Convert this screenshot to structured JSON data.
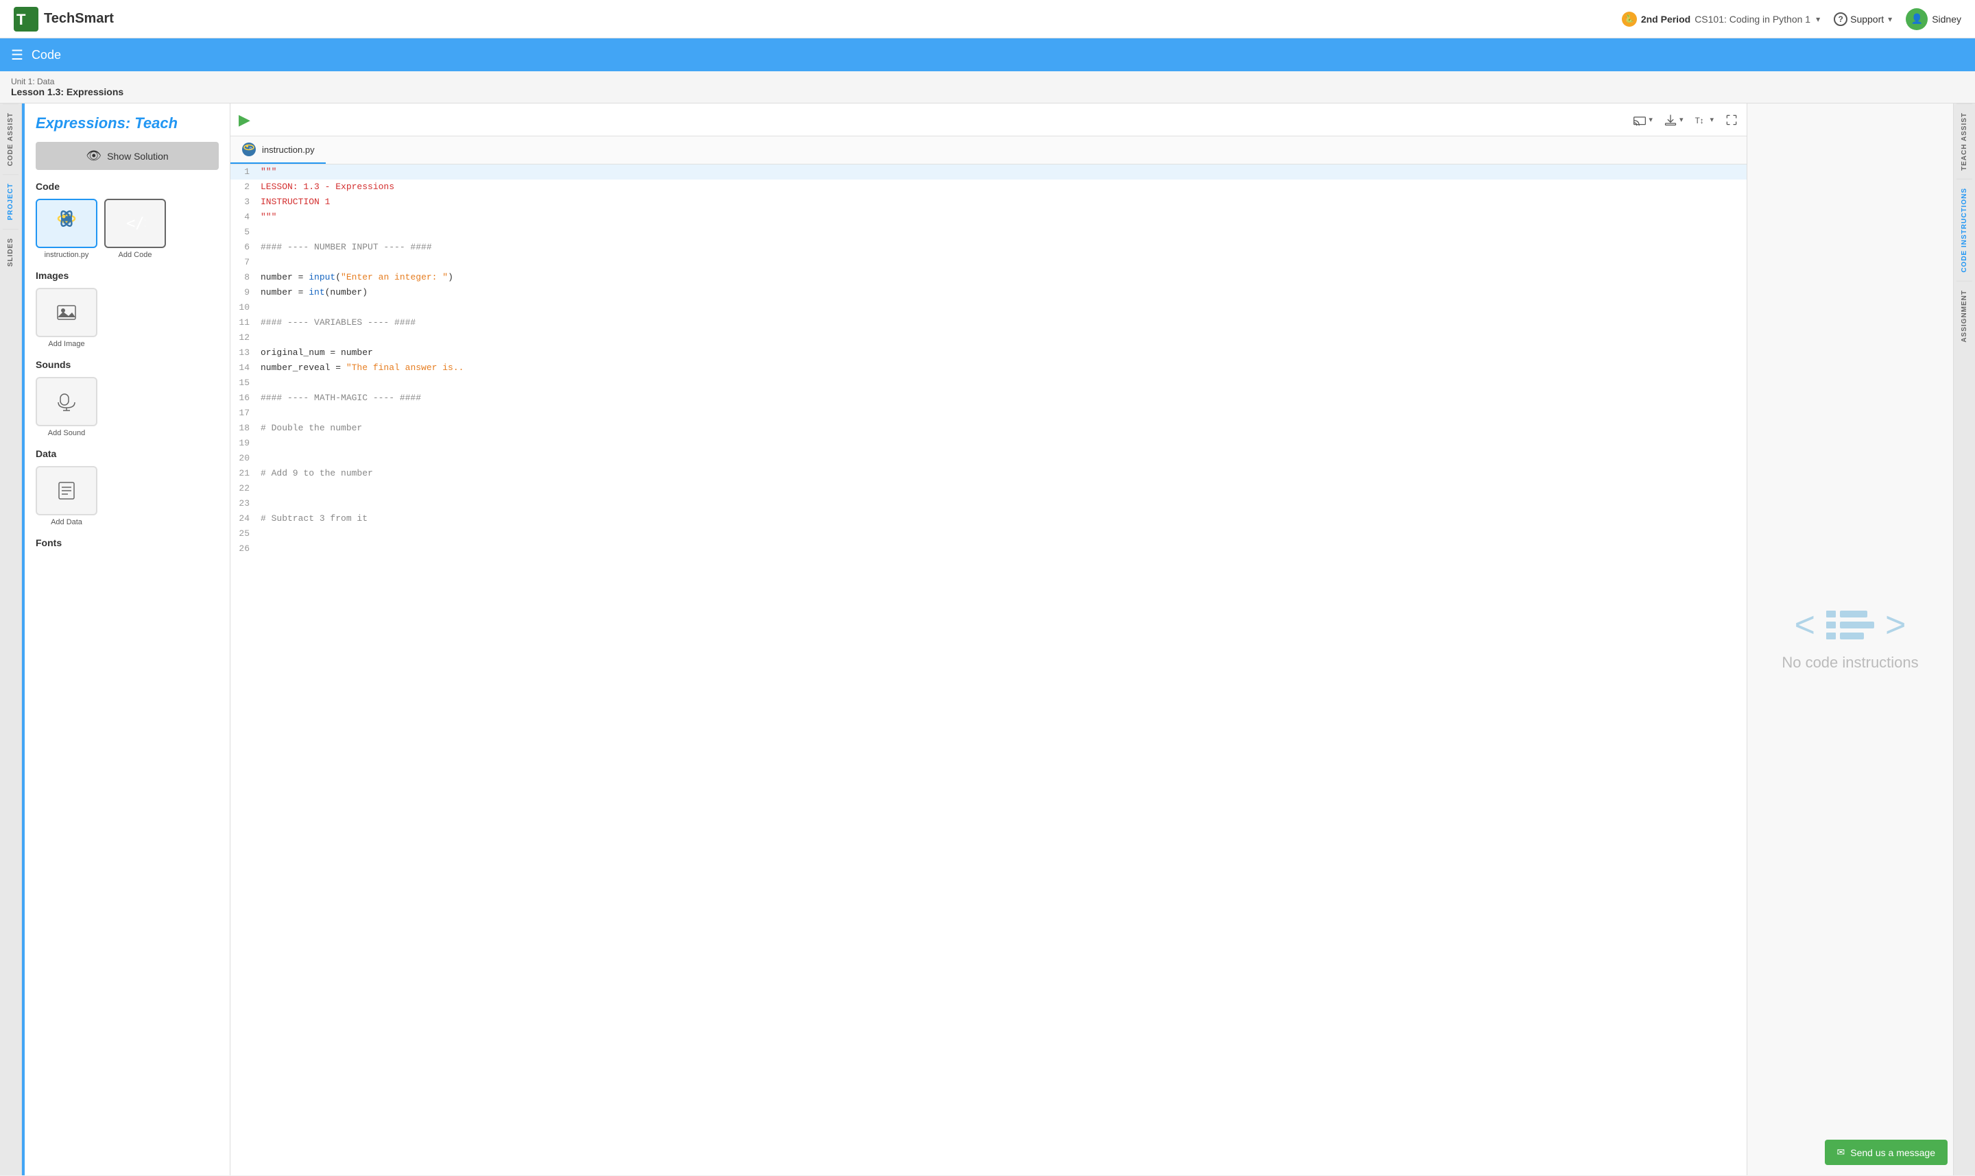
{
  "topnav": {
    "logo_text": "TechSmart",
    "period_icon": "🐍",
    "period_label": "2nd Period",
    "course_label": "CS101: Coding in Python 1",
    "support_label": "Support",
    "user_name": "Sidney"
  },
  "bluebar": {
    "title": "Code"
  },
  "breadcrumb": {
    "unit": "Unit 1: Data",
    "lesson": "Lesson 1.3: Expressions"
  },
  "project_panel": {
    "title": "Expressions: Teach",
    "show_solution": "Show Solution",
    "code_section": "Code",
    "files": [
      {
        "name": "instruction.py",
        "selected": true,
        "type": "python"
      },
      {
        "name": "Add Code",
        "selected": false,
        "type": "add"
      }
    ],
    "images_section": "Images",
    "add_image": "Add Image",
    "sounds_section": "Sounds",
    "add_sound": "Add Sound",
    "data_section": "Data",
    "add_data": "Add Data",
    "fonts_section": "Fonts"
  },
  "editor": {
    "file_tab": "instruction.py",
    "run_label": "▶",
    "toolbar_buttons": [
      "cast",
      "download",
      "font-size",
      "fullscreen"
    ],
    "lines": [
      {
        "num": 1,
        "content": "\"\"\"",
        "style": "red",
        "highlighted": true
      },
      {
        "num": 2,
        "content": "LESSON: 1.3 - Expressions",
        "style": "red",
        "highlighted": false
      },
      {
        "num": 3,
        "content": "INSTRUCTION 1",
        "style": "red",
        "highlighted": false
      },
      {
        "num": 4,
        "content": "\"\"\"",
        "style": "red",
        "highlighted": false
      },
      {
        "num": 5,
        "content": "",
        "style": "default",
        "highlighted": false
      },
      {
        "num": 6,
        "content": "#### ---- NUMBER INPUT ---- ####",
        "style": "gray",
        "highlighted": false
      },
      {
        "num": 7,
        "content": "",
        "style": "default",
        "highlighted": false
      },
      {
        "num": 8,
        "content": "number = input(\"Enter an integer: \")",
        "style": "mixed_input",
        "highlighted": false
      },
      {
        "num": 9,
        "content": "number = int(number)",
        "style": "mixed_int",
        "highlighted": false
      },
      {
        "num": 10,
        "content": "",
        "style": "default",
        "highlighted": false
      },
      {
        "num": 11,
        "content": "#### ---- VARIABLES ---- ####",
        "style": "gray",
        "highlighted": false
      },
      {
        "num": 12,
        "content": "",
        "style": "default",
        "highlighted": false
      },
      {
        "num": 13,
        "content": "original_num = number",
        "style": "default",
        "highlighted": false
      },
      {
        "num": 14,
        "content": "number_reveal = \"The final answer is..",
        "style": "mixed_string",
        "highlighted": false
      },
      {
        "num": 15,
        "content": "",
        "style": "default",
        "highlighted": false
      },
      {
        "num": 16,
        "content": "#### ---- MATH-MAGIC ---- ####",
        "style": "gray",
        "highlighted": false
      },
      {
        "num": 17,
        "content": "",
        "style": "default",
        "highlighted": false
      },
      {
        "num": 18,
        "content": "# Double the number",
        "style": "comment",
        "highlighted": false
      },
      {
        "num": 19,
        "content": "",
        "style": "default",
        "highlighted": false
      },
      {
        "num": 20,
        "content": "",
        "style": "default",
        "highlighted": false
      },
      {
        "num": 21,
        "content": "# Add 9 to the number",
        "style": "comment",
        "highlighted": false
      },
      {
        "num": 22,
        "content": "",
        "style": "default",
        "highlighted": false
      },
      {
        "num": 23,
        "content": "",
        "style": "default",
        "highlighted": false
      },
      {
        "num": 24,
        "content": "# Subtract 3 from it",
        "style": "comment",
        "highlighted": false
      },
      {
        "num": 25,
        "content": "",
        "style": "default",
        "highlighted": false
      },
      {
        "num": 26,
        "content": "",
        "style": "default",
        "highlighted": false
      }
    ]
  },
  "code_instructions": {
    "empty_text": "No code instructions"
  },
  "side_tabs": {
    "left": [
      "CODE ASSIST",
      "PROJECT",
      "SLIDES"
    ],
    "right": [
      "TEACH ASSIST",
      "CODE INSTRUCTIONS",
      "ASSIGNMENT"
    ]
  },
  "send_message": {
    "label": "Send us a message",
    "icon": "✉"
  }
}
